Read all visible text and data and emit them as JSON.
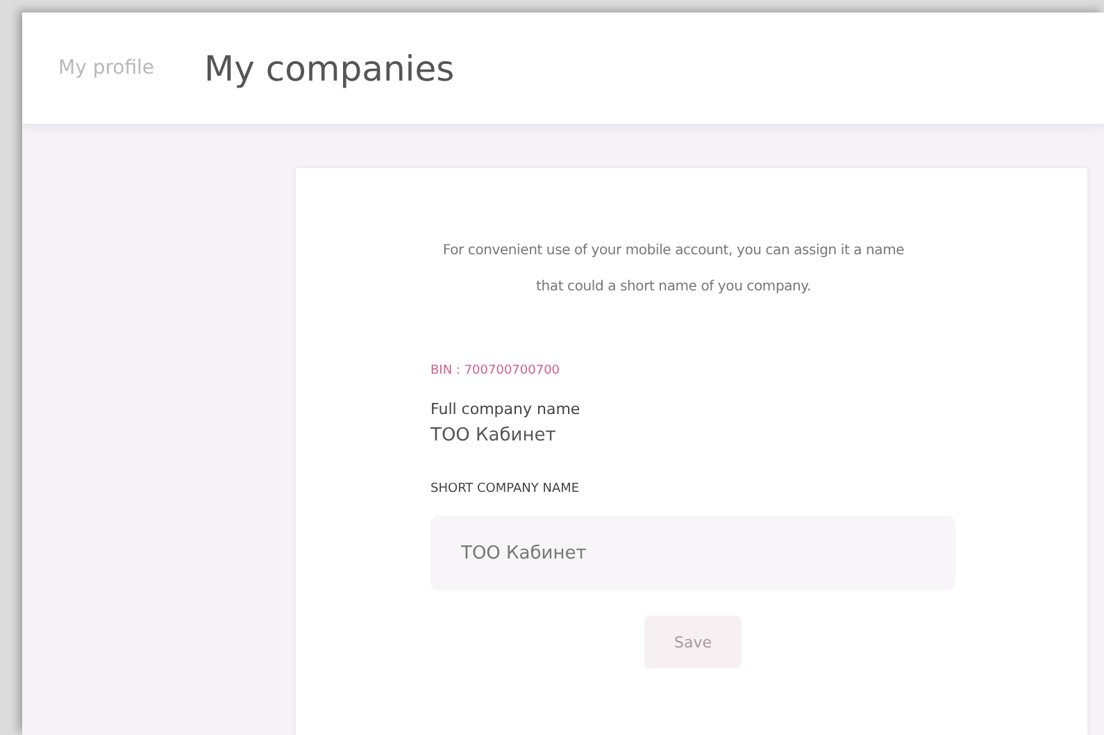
{
  "tabs": [
    {
      "label": "My profile",
      "selected": false
    },
    {
      "label": "My companies",
      "selected": true
    }
  ],
  "card": {
    "description": "For convenient use of your mobile account, you can assign it a name that could a short name of you company.",
    "bin": "BIN : 700700700700",
    "full_name_label": "Full company name",
    "full_name": "ТОО Кабинет",
    "short_name_label": "SHORT COMPANY NAME",
    "short_name_field": {
      "value": "ТОО Кабинет"
    },
    "save_button": {
      "label": "Save",
      "disabled": true
    }
  }
}
